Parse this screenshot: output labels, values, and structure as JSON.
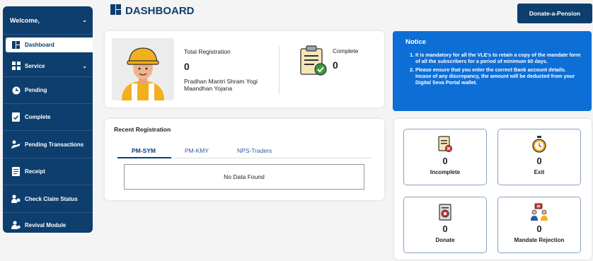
{
  "sidebar": {
    "welcome": "Welcome,",
    "items": [
      {
        "label": "Dashboard",
        "icon": "dashboard-icon"
      },
      {
        "label": "Service",
        "icon": "grid-icon"
      },
      {
        "label": "Pending",
        "icon": "pending-icon"
      },
      {
        "label": "Complete",
        "icon": "complete-icon"
      },
      {
        "label": "Pending Transactions",
        "icon": "transactions-icon"
      },
      {
        "label": "Receipt",
        "icon": "receipt-icon"
      },
      {
        "label": "Check Claim Status",
        "icon": "claim-icon"
      },
      {
        "label": "Revival Module",
        "icon": "revival-icon"
      }
    ]
  },
  "header": {
    "title": "DASHBOARD",
    "donate_button": "Donate-a-Pension"
  },
  "registration": {
    "total_label": "Total Registration",
    "total_value": "0",
    "scheme": "Pradhan Mantri Shram Yogi Maandhan Yojana",
    "complete_label": "Complete",
    "complete_value": "0"
  },
  "notice": {
    "title": "Notice",
    "items": [
      "It is mandatory for all the VLE's to retain a copy of the mandate form of all the subscribers for a period of minimum 60 days.",
      "Please ensure that you enter the correct Bank account details. Incase of any discrepancy, the amount will be deducted from your Digital Seva Portal wallet."
    ]
  },
  "recent": {
    "title": "Recent Registration",
    "tabs": [
      "PM-SYM",
      "PM-KMY",
      "NPS-Traders"
    ],
    "empty_text": "No Data Found"
  },
  "stats": [
    {
      "label": "Incomplete",
      "value": "0",
      "icon": "incomplete-doc-icon"
    },
    {
      "label": "Exit",
      "value": "0",
      "icon": "stopwatch-icon"
    },
    {
      "label": "Donate",
      "value": "0",
      "icon": "donate-doc-icon"
    },
    {
      "label": "Mandate Rejection",
      "value": "0",
      "icon": "rejection-people-icon"
    }
  ],
  "colors": {
    "primary": "#0d3e6e",
    "notice_bg": "#0d6ed6",
    "complete_green": "#3a9a3a",
    "alert_red": "#d33"
  }
}
